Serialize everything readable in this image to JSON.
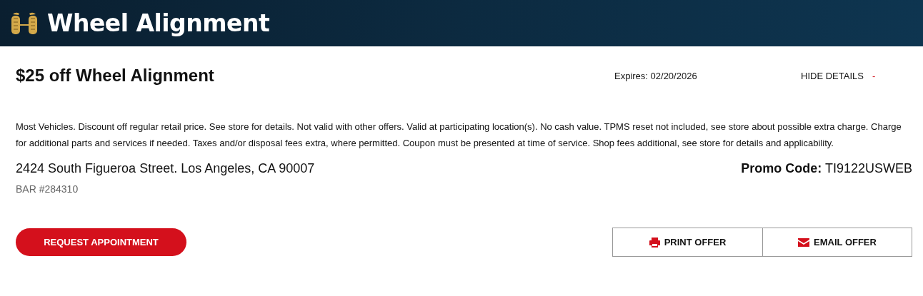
{
  "header": {
    "title": "Wheel Alignment"
  },
  "offer": {
    "title": "$25 off Wheel Alignment",
    "expires": "Expires: 02/20/2026",
    "toggle_label": "HIDE DETAILS",
    "toggle_sign": "-",
    "terms": "Most Vehicles. Discount off regular retail price. See store for details. Not valid with other offers. Valid at participating location(s). No cash value. TPMS reset not included, see store about possible extra charge. Charge for additional parts and services if needed. Taxes and/or disposal fees extra, where permitted. Coupon must be presented at time of service. Shop fees additional, see store for details and applicability.",
    "address": "2424 South Figueroa Street. Los Angeles, CA 90007",
    "bar": "BAR #284310",
    "promo_label": "Promo Code:",
    "promo_code": "TI9122USWEB"
  },
  "actions": {
    "primary": "REQUEST APPOINTMENT",
    "secondary": [
      {
        "kind": "print",
        "label": "PRINT OFFER"
      },
      {
        "kind": "email",
        "label": "EMAIL OFFER"
      }
    ]
  }
}
